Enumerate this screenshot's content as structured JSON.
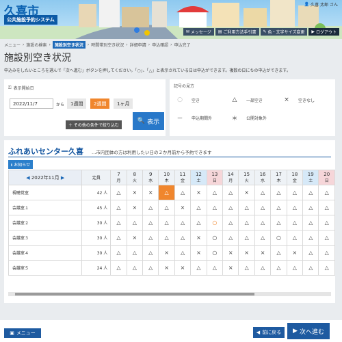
{
  "header": {
    "logo_title": "久喜市",
    "logo_subtitle": "公共施設予約システム",
    "user_name": "久喜 太郎 さん",
    "buttons": [
      "メッセージ",
      "ご利用方法手引書",
      "色・文字サイズ変更",
      "ログアウト"
    ]
  },
  "breadcrumb": [
    "メニュー",
    "施設の検索",
    "施設別空き状況",
    "時間帯別空き状況",
    "詳細申請",
    "申込確認",
    "申込完了"
  ],
  "page": {
    "title": "施設別空き状況",
    "description": "申込みをしたいところを選んで「次へ進む」ボタンを押してください。「○」、「△」と表示されている日は申込ができます。複数の日にちの申込ができます。"
  },
  "search": {
    "start_label": "表示開始日",
    "date_value": "2022/11/7",
    "kara": "から",
    "periods": [
      "1週間",
      "2週間",
      "1ヶ月"
    ],
    "selected_period": 1,
    "more_button": "その他の条件で絞り込む",
    "show_button": "表示"
  },
  "legend": {
    "title": "記号の見方",
    "items": [
      {
        "sym": "○",
        "label": "空き"
      },
      {
        "sym": "△",
        "label": "一部空き"
      },
      {
        "sym": "×",
        "label": "空きなし"
      },
      {
        "sym": "－",
        "label": "申込期間外"
      },
      {
        "sym": "＊",
        "label": "公開対象外"
      }
    ]
  },
  "facility": {
    "name": "ふれあいセンター久喜",
    "note": "…市内団体の方は利用したい日の２か月前から予約できます",
    "info_button": "お知らせ",
    "month": "2022年11月",
    "capacity_header": "定員",
    "days": [
      {
        "d": "7",
        "w": "月",
        "t": ""
      },
      {
        "d": "8",
        "w": "火",
        "t": ""
      },
      {
        "d": "9",
        "w": "水",
        "t": ""
      },
      {
        "d": "10",
        "w": "木",
        "t": ""
      },
      {
        "d": "11",
        "w": "金",
        "t": ""
      },
      {
        "d": "12",
        "w": "土",
        "t": "sat"
      },
      {
        "d": "13",
        "w": "日",
        "t": "sun"
      },
      {
        "d": "14",
        "w": "月",
        "t": ""
      },
      {
        "d": "15",
        "w": "火",
        "t": ""
      },
      {
        "d": "16",
        "w": "水",
        "t": ""
      },
      {
        "d": "17",
        "w": "木",
        "t": ""
      },
      {
        "d": "18",
        "w": "金",
        "t": ""
      },
      {
        "d": "19",
        "w": "土",
        "t": "sat"
      },
      {
        "d": "20",
        "w": "日",
        "t": "sun"
      }
    ],
    "rooms": [
      {
        "name": "視聴覚室",
        "cap": "42 人",
        "cells": [
          "△",
          "×",
          "×",
          "△",
          "△",
          "×",
          "△",
          "△",
          "×",
          "△",
          "△",
          "△",
          "△",
          "△"
        ],
        "sel": [
          3
        ],
        "ring": []
      },
      {
        "name": "会議室１",
        "cap": "45 人",
        "cells": [
          "△",
          "×",
          "△",
          "△",
          "×",
          "△",
          "△",
          "△",
          "△",
          "△",
          "△",
          "△",
          "△",
          "△"
        ],
        "sel": [],
        "ring": []
      },
      {
        "name": "会議室２",
        "cap": "30 人",
        "cells": [
          "△",
          "△",
          "△",
          "△",
          "△",
          "△",
          "○",
          "△",
          "△",
          "△",
          "△",
          "△",
          "△",
          "△"
        ],
        "sel": [],
        "ring": [
          6
        ]
      },
      {
        "name": "会議室３",
        "cap": "30 人",
        "cells": [
          "△",
          "×",
          "△",
          "△",
          "△",
          "×",
          "○",
          "△",
          "△",
          "△",
          "○",
          "△",
          "△",
          "△"
        ],
        "sel": [],
        "ring": []
      },
      {
        "name": "会議室４",
        "cap": "30 人",
        "cells": [
          "△",
          "△",
          "△",
          "×",
          "△",
          "×",
          "○",
          "×",
          "×",
          "×",
          "△",
          "×",
          "△",
          "△"
        ],
        "sel": [],
        "ring": []
      },
      {
        "name": "会議室５",
        "cap": "24 人",
        "cells": [
          "△",
          "△",
          "△",
          "×",
          "×",
          "△",
          "△",
          "×",
          "△",
          "△",
          "△",
          "△",
          "△",
          "△"
        ],
        "sel": [],
        "ring": []
      }
    ]
  },
  "footer": {
    "menu": "メニュー",
    "back": "前に戻る",
    "next": "次へ進む"
  }
}
